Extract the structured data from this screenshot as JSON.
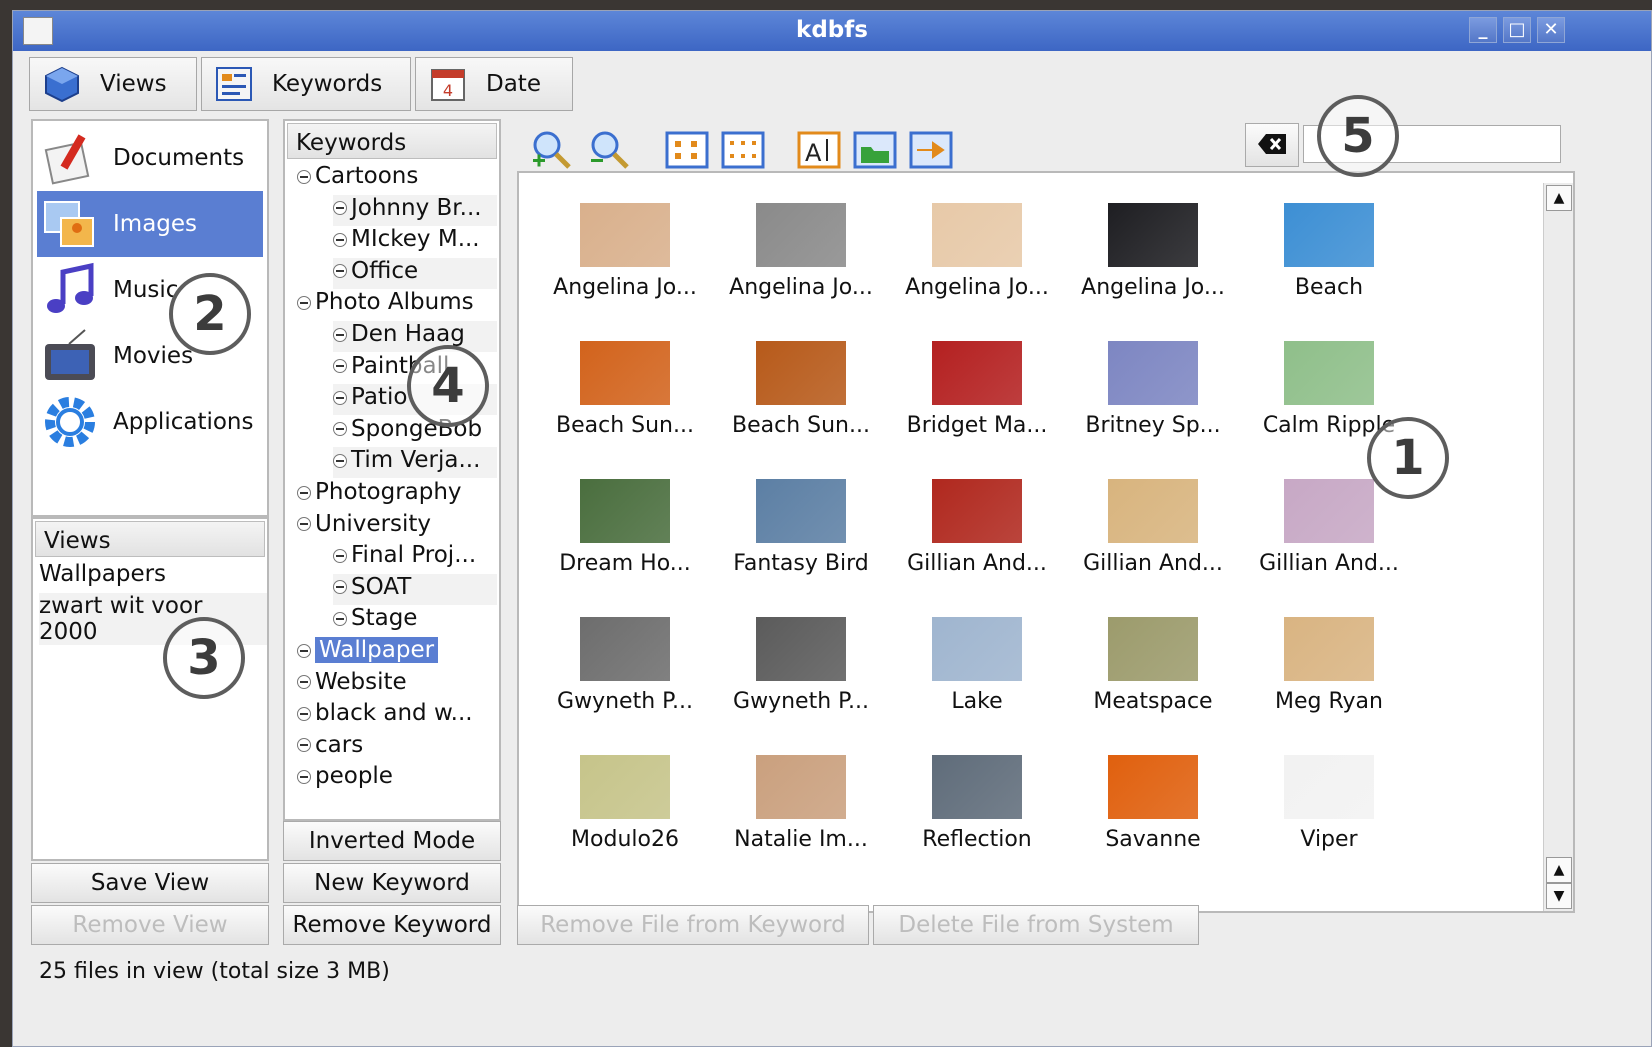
{
  "window": {
    "title": "kdbfs"
  },
  "tabs": [
    {
      "label": "Views",
      "icon": "cube-icon"
    },
    {
      "label": "Keywords",
      "icon": "keywords-icon"
    },
    {
      "label": "Date",
      "icon": "calendar-icon"
    }
  ],
  "categories": [
    {
      "label": "Documents",
      "icon": "documents-icon"
    },
    {
      "label": "Images",
      "icon": "images-icon"
    },
    {
      "label": "Music",
      "icon": "music-icon"
    },
    {
      "label": "Movies",
      "icon": "movies-icon"
    },
    {
      "label": "Applications",
      "icon": "gear-icon"
    }
  ],
  "views_panel": {
    "header": "Views",
    "items": [
      "Wallpapers",
      "zwart wit voor 2000"
    ],
    "save_button": "Save View",
    "remove_button": "Remove View"
  },
  "keywords_panel": {
    "header": "Keywords",
    "tree": [
      {
        "label": "Cartoons",
        "level": 0
      },
      {
        "label": "Johnny Br...",
        "level": 1
      },
      {
        "label": "MIckey M...",
        "level": 1
      },
      {
        "label": "Office",
        "level": 1
      },
      {
        "label": "Photo Albums",
        "level": 0
      },
      {
        "label": "Den Haag",
        "level": 1
      },
      {
        "label": "Paintball",
        "level": 1
      },
      {
        "label": "Patio",
        "level": 1
      },
      {
        "label": "SpongeBob",
        "level": 1
      },
      {
        "label": "Tim Verja...",
        "level": 1
      },
      {
        "label": "Photography",
        "level": 0
      },
      {
        "label": "University",
        "level": 0
      },
      {
        "label": "Final Proj...",
        "level": 1
      },
      {
        "label": "SOAT",
        "level": 1
      },
      {
        "label": "Stage",
        "level": 1
      },
      {
        "label": "Wallpaper",
        "level": 0
      },
      {
        "label": "Website",
        "level": 0
      },
      {
        "label": "black and w...",
        "level": 0
      },
      {
        "label": "cars",
        "level": 0
      },
      {
        "label": "people",
        "level": 0
      }
    ],
    "inverted_button": "Inverted Mode",
    "new_button": "New Keyword",
    "remove_button": "Remove Keyword"
  },
  "toolbar": [
    {
      "icon": "zoom-in-icon"
    },
    {
      "icon": "zoom-out-icon"
    },
    {
      "icon": "large-icons-view-icon"
    },
    {
      "icon": "small-icons-view-icon"
    },
    {
      "icon": "rename-icon"
    },
    {
      "icon": "folder-icon"
    },
    {
      "icon": "export-icon"
    }
  ],
  "search": {
    "clear_icon": "clear-icon",
    "value": ""
  },
  "files": [
    {
      "label": "Angelina Jo...",
      "color": "#d9b08c"
    },
    {
      "label": "Angelina Jo...",
      "color": "#8a8a8a"
    },
    {
      "label": "Angelina Jo...",
      "color": "#e7c9a8"
    },
    {
      "label": "Angelina Jo...",
      "color": "#1e1e22"
    },
    {
      "label": "Beach",
      "color": "#3d8fd4"
    },
    {
      "label": "Beach Sun...",
      "color": "#d2631c"
    },
    {
      "label": "Beach Sun...",
      "color": "#b75a1a"
    },
    {
      "label": "Bridget Ma...",
      "color": "#b42020"
    },
    {
      "label": "Britney Sp...",
      "color": "#7d86c2"
    },
    {
      "label": "Calm Ripple",
      "color": "#8fbf8a"
    },
    {
      "label": "Dream Ho...",
      "color": "#4a6e3e"
    },
    {
      "label": "Fantasy Bird",
      "color": "#5c7fa4"
    },
    {
      "label": "Gillian And...",
      "color": "#b0281e"
    },
    {
      "label": "Gillian And...",
      "color": "#d8b47e"
    },
    {
      "label": "Gillian And...",
      "color": "#c7a8c5"
    },
    {
      "label": "Gwyneth P...",
      "color": "#6d6d6d"
    },
    {
      "label": "Gwyneth P...",
      "color": "#5b5b5b"
    },
    {
      "label": "Lake",
      "color": "#9fb5cf"
    },
    {
      "label": "Meatspace",
      "color": "#9c9b6c"
    },
    {
      "label": "Meg Ryan",
      "color": "#d9b482"
    },
    {
      "label": "Modulo26",
      "color": "#c6c48a"
    },
    {
      "label": "Natalie Im...",
      "color": "#caa07e"
    },
    {
      "label": "Reflection",
      "color": "#5f6c7a"
    },
    {
      "label": "Savanne",
      "color": "#e0600e"
    },
    {
      "label": "Viper",
      "color": "#f2f2f2"
    }
  ],
  "file_actions": {
    "remove_from_keyword": "Remove File from Keyword",
    "delete_from_system": "Delete File from System"
  },
  "status": "25 files in view (total size 3 MB)",
  "callouts": [
    "1",
    "2",
    "3",
    "4",
    "5"
  ]
}
